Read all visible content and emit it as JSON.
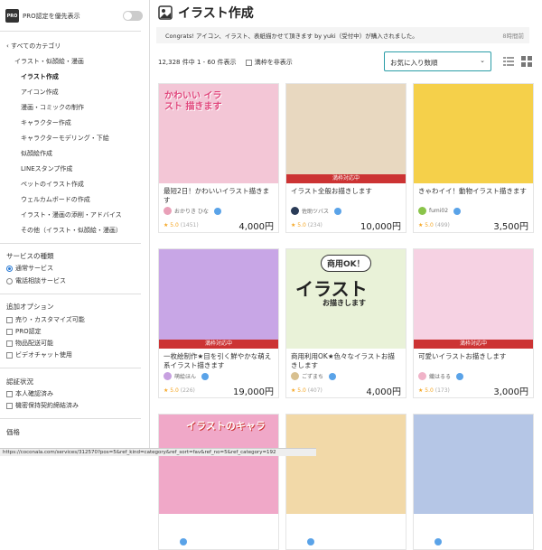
{
  "sidebar": {
    "pro_badge": "PRO",
    "pro_label": "PRO認定を優先表示",
    "all_categories": "‹ すべてのカテゴリ",
    "parent_category": "イラスト・似顔絵・漫画",
    "categories": [
      "イラスト作成",
      "アイコン作成",
      "漫画・コミックの制作",
      "キャラクター作成",
      "キャラクターモデリング・下絵",
      "似顔絵作成",
      "LINEスタンプ作成",
      "ペットのイラスト作成",
      "ウェルカムボードの作成",
      "イラスト・漫画の添削・アドバイス",
      "その他（イラスト・似顔絵・漫画）"
    ],
    "service_type_heading": "サービスの種類",
    "service_types": [
      "通常サービス",
      "電話相談サービス"
    ],
    "options_heading": "追加オプション",
    "options": [
      "売り・カスタマイズ可能",
      "PRO認定",
      "物品配送可能",
      "ビデオチャット使用"
    ],
    "verify_heading": "認証状況",
    "verifications": [
      "本人確認済み",
      "機密保持契約締結済み"
    ],
    "price_heading": "価格"
  },
  "main": {
    "title": "イラスト作成",
    "notice_text": "Congrats! アイコン、イラスト、表紙描かせて頂きます by yuki（受付中）が購入されました。",
    "notice_time": "8時間前",
    "result_count": "12,328 件中 1 - 60 件表示",
    "hide_closed": "満枠を非表示",
    "sort_value": "お気に入り数順",
    "in_progress_label": "満枠対応中",
    "cards": [
      {
        "title": "最短2日！かわいいイラスト描きます",
        "user": "おかりき ひな",
        "rating": "★ 5.0",
        "reviews": "(1451)",
        "price": "4,000円",
        "band": false,
        "bg": "#f3c6d6",
        "av": "#e9a0b8"
      },
      {
        "title": "イラスト全般お描きします",
        "user": "佐助ツバス",
        "rating": "★ 5.0",
        "reviews": "(234)",
        "price": "10,000円",
        "band": true,
        "bg": "#e8d8c0",
        "av": "#2a3b57"
      },
      {
        "title": "きゃわイイ！動物イラスト描きます",
        "user": "fumi02",
        "rating": "★ 5.0",
        "reviews": "(499)",
        "price": "3,500円",
        "band": false,
        "bg": "#f5d04a",
        "av": "#8ac44a"
      },
      {
        "title": "一枚絵制作★目を引く鮮やかな萌え系イラスト描きます",
        "user": "萌絵ほん",
        "rating": "★ 5.0",
        "reviews": "(226)",
        "price": "19,000円",
        "band": true,
        "bg": "#c8a6e6",
        "av": "#c7a0e0"
      },
      {
        "title": "商用利用OK★色々なイラストお描きします",
        "user": "ごずまち",
        "rating": "★ 5.0",
        "reviews": "(407)",
        "price": "4,000円",
        "band": false,
        "bg": "#e9f2d8",
        "av": "#d8c090"
      },
      {
        "title": "可愛いイラストお描きします",
        "user": "織はるる",
        "rating": "★ 5.0",
        "reviews": "(173)",
        "price": "3,000円",
        "band": true,
        "bg": "#f6d2e3",
        "av": "#f0b3c8"
      },
      {
        "title": "",
        "user": "",
        "rating": "",
        "reviews": "",
        "price": "",
        "band": false,
        "bg": "#f0a8c8",
        "av": "#fff"
      },
      {
        "title": "",
        "user": "",
        "rating": "",
        "reviews": "",
        "price": "",
        "band": false,
        "bg": "#f2d9a8",
        "av": "#fff"
      },
      {
        "title": "",
        "user": "",
        "rating": "",
        "reviews": "",
        "price": "",
        "band": false,
        "bg": "#b5c6e6",
        "av": "#fff"
      }
    ],
    "card1_caption": "かわいい イラスト 描きます",
    "card5_bubble": "商用OK！",
    "card5_caption": "イラスト",
    "card5_sub": "お描きします",
    "card7_caption": "イラストのキャラ"
  },
  "status_url": "https://coconala.com/services/312570?pos=5&ref_kind=category&ref_sort=fav&ref_no=5&ref_category=192"
}
